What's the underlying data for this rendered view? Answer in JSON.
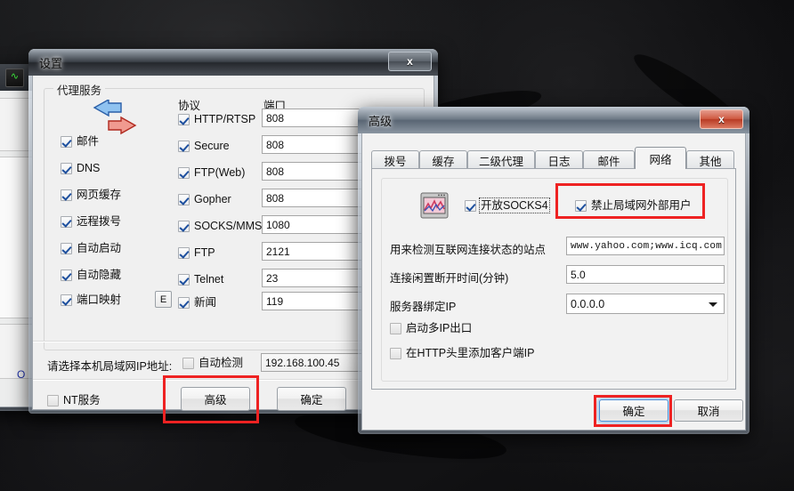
{
  "desktop": {
    "description": "dark textured wallpaper"
  },
  "background_window": {
    "app_icon": "green-monitor-icon",
    "fragment_text": "O"
  },
  "settings_window": {
    "title": "设置",
    "close_label": "x",
    "group": {
      "legend": "代理服务",
      "arrows_icon": "blue-red-exchange-arrows-icon"
    },
    "left_checkboxes": [
      {
        "label": "邮件",
        "checked": true
      },
      {
        "label": "DNS",
        "checked": true
      },
      {
        "label": "网页缓存",
        "checked": true
      },
      {
        "label": "远程拨号",
        "checked": true
      },
      {
        "label": "自动启动",
        "checked": true
      },
      {
        "label": "自动隐藏",
        "checked": true
      },
      {
        "label": "端口映射",
        "checked": true
      }
    ],
    "e_button": "E",
    "protocol_header": "协议",
    "port_header": "端口",
    "protocols": [
      {
        "label": "HTTP/RTSP",
        "checked": true,
        "port": "808"
      },
      {
        "label": "Secure",
        "checked": true,
        "port": "808"
      },
      {
        "label": "FTP(Web)",
        "checked": true,
        "port": "808"
      },
      {
        "label": "Gopher",
        "checked": true,
        "port": "808"
      },
      {
        "label": "SOCKS/MMS",
        "checked": true,
        "port": "1080"
      },
      {
        "label": "FTP",
        "checked": true,
        "port": "2121"
      },
      {
        "label": "Telnet",
        "checked": true,
        "port": "23"
      },
      {
        "label": "新闻",
        "checked": true,
        "port": "119"
      }
    ],
    "ip_row": {
      "label": "请选择本机局域网IP地址:",
      "auto_detect_label": "自动检测",
      "auto_detect_checked": false,
      "ip_value": "192.168.100.45"
    },
    "nt_service": {
      "label": "NT服务",
      "checked": false
    },
    "buttons": {
      "advanced": "高级",
      "ok": "确定"
    }
  },
  "advanced_window": {
    "title": "高级",
    "close_label": "x",
    "tabs": [
      {
        "label": "拨号",
        "active": false
      },
      {
        "label": "缓存",
        "active": false
      },
      {
        "label": "二级代理",
        "active": false
      },
      {
        "label": "日志",
        "active": false
      },
      {
        "label": "邮件",
        "active": false
      },
      {
        "label": "网络",
        "active": true
      },
      {
        "label": "其他",
        "active": false
      }
    ],
    "network_tab": {
      "monitor_icon": "network-monitor-chart-icon",
      "socks4": {
        "label": "开放SOCKS4",
        "checked": true,
        "focused": true
      },
      "block_external": {
        "label": "禁止局域网外部用户",
        "checked": true
      },
      "detect_sites": {
        "label": "用来检测互联网连接状态的站点",
        "value": "www.yahoo.com;www.icq.com;ww"
      },
      "idle_timeout": {
        "label": "连接闲置断开时间(分钟)",
        "value": "5.0"
      },
      "bind_ip": {
        "label": "服务器绑定IP",
        "value": "0.0.0.0"
      },
      "multi_ip": {
        "label": "启动多IP出口",
        "checked": false
      },
      "http_client_ip": {
        "label": "在HTTP头里添加客户端IP",
        "checked": false
      }
    },
    "buttons": {
      "ok": "确定",
      "cancel": "取消"
    }
  },
  "annotations": {
    "color": "#ee2222",
    "boxes": [
      "advanced-button",
      "block-external-checkbox",
      "advanced-ok-button"
    ]
  }
}
